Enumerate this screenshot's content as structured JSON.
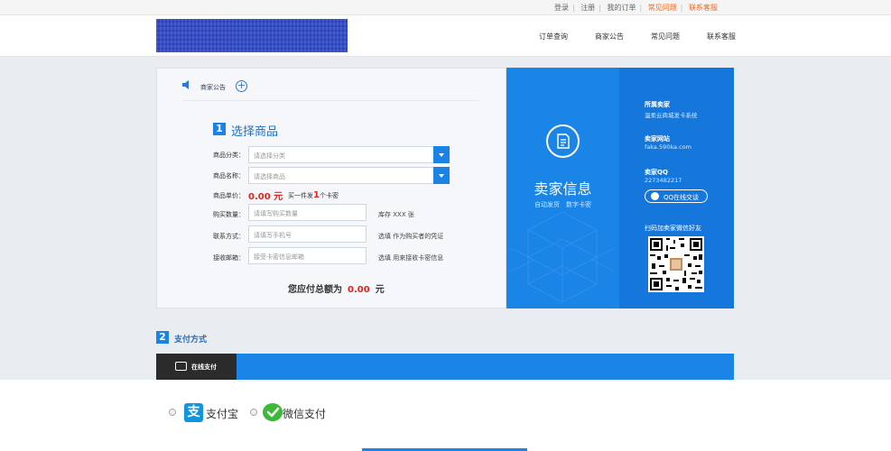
{
  "topbar": {
    "links": [
      "登录",
      "注册",
      "我的订单",
      "常见问题",
      "联系客服"
    ]
  },
  "nav": {
    "items": [
      "订单查询",
      "商家公告",
      "常见问题",
      "联系客服"
    ]
  },
  "notice": {
    "label": "商家公告"
  },
  "step1": {
    "number": "1",
    "title": "选择商品",
    "category_label": "商品分类：",
    "category_placeholder": "请选择分类",
    "product_label": "商品名称：",
    "product_placeholder": "请选择商品",
    "unit_price_label": "商品单价：",
    "unit_price": "0.00 元",
    "buy_note_prefix": "买一件发",
    "buy_note_count": "1",
    "buy_note_suffix": "个卡密",
    "quantity_label": "购买数量：",
    "quantity_placeholder": "请填写购买数量",
    "stock_hint": "库存 XXX 张",
    "contact_label": "联系方式：",
    "contact_placeholder": "请填写手机号",
    "contact_hint": "选填 作为购买者的凭证",
    "email_label": "接收邮箱：",
    "email_placeholder": "接受卡密信息邮箱",
    "email_hint": "选填 用来接收卡密信息",
    "total_label": "您应付总额为",
    "total_value": "0.00",
    "total_unit": "元"
  },
  "seller": {
    "title": "卖家信息",
    "subtitle": "自动发货　数字卡密",
    "store_label": "所属卖家",
    "store_value": "温柔云商城发卡系统",
    "site_label": "卖家网站",
    "site_value": "faka.590ka.com",
    "qq_label": "卖家QQ",
    "qq_value": "2273482217",
    "qq_button": "QQ在线交谈",
    "scan_label": "扫码加卖家微信好友"
  },
  "step2": {
    "number": "2",
    "title": "支付方式",
    "tab_label": "在线支付",
    "options": [
      "支付宝",
      "微信支付"
    ]
  },
  "colors": {
    "primary_blue": "#1b84e7",
    "price_red": "#e0231c",
    "topbar_highlight": "#f26a1b"
  }
}
